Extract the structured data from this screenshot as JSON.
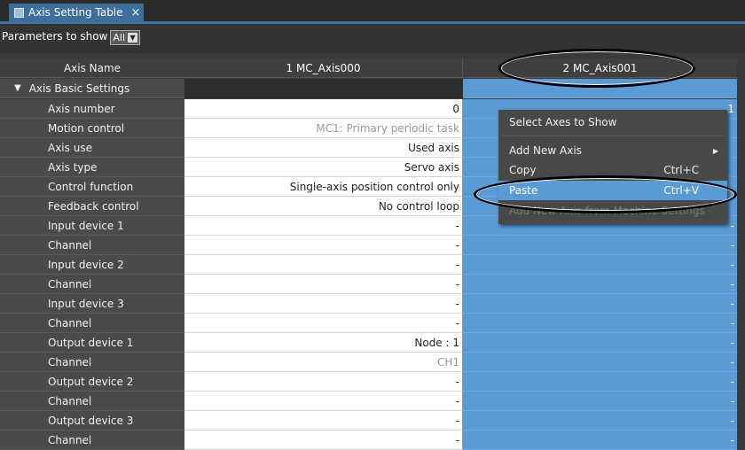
{
  "tab": {
    "title": "Axis Setting Table",
    "close": "×"
  },
  "filter": {
    "label": "Parameters to show",
    "value": "All"
  },
  "columns": {
    "name": "Axis Name",
    "axis1": "1 MC_Axis000",
    "axis2": "2 MC_Axis001"
  },
  "section": {
    "title": "Axis Basic Settings"
  },
  "rows": [
    {
      "name": "Axis number",
      "v1": "0",
      "v2": "1"
    },
    {
      "name": "Motion control",
      "v1": "MC1: Primary periodic task",
      "v2": ""
    },
    {
      "name": "Axis use",
      "v1": "Used axis",
      "v2": ""
    },
    {
      "name": "Axis type",
      "v1": "Servo axis",
      "v2": ""
    },
    {
      "name": "Control function",
      "v1": "Single-axis position control only",
      "v2": ""
    },
    {
      "name": "Feedback control",
      "v1": "No control loop",
      "v2": ""
    },
    {
      "name": "Input device 1",
      "v1": "-",
      "v2": "-"
    },
    {
      "name": "Channel",
      "v1": "-",
      "v2": "-"
    },
    {
      "name": "Input device 2",
      "v1": "-",
      "v2": "-"
    },
    {
      "name": "Channel",
      "v1": "-",
      "v2": "-"
    },
    {
      "name": "Input device 3",
      "v1": "-",
      "v2": "-"
    },
    {
      "name": "Channel",
      "v1": "-",
      "v2": "-"
    },
    {
      "name": "Output device 1",
      "v1": "Node : 1",
      "v2": "-"
    },
    {
      "name": "Channel",
      "v1": "CH1",
      "v2": "-"
    },
    {
      "name": "Output device 2",
      "v1": "-",
      "v2": "-"
    },
    {
      "name": "Channel",
      "v1": "-",
      "v2": "-"
    },
    {
      "name": "Output device 3",
      "v1": "-",
      "v2": "-"
    },
    {
      "name": "Channel",
      "v1": "-",
      "v2": "-"
    }
  ],
  "context_menu": {
    "select_axes": "Select Axes to Show",
    "add_new_axis": "Add New Axis",
    "copy": "Copy",
    "copy_shortcut": "Ctrl+C",
    "paste": "Paste",
    "paste_shortcut": "Ctrl+V",
    "disabled_item": "Add New Axis from Machine Settings"
  },
  "colors": {
    "accent": "#5b9bd5",
    "tab": "#3d6e9c",
    "annotation": "#000000"
  }
}
